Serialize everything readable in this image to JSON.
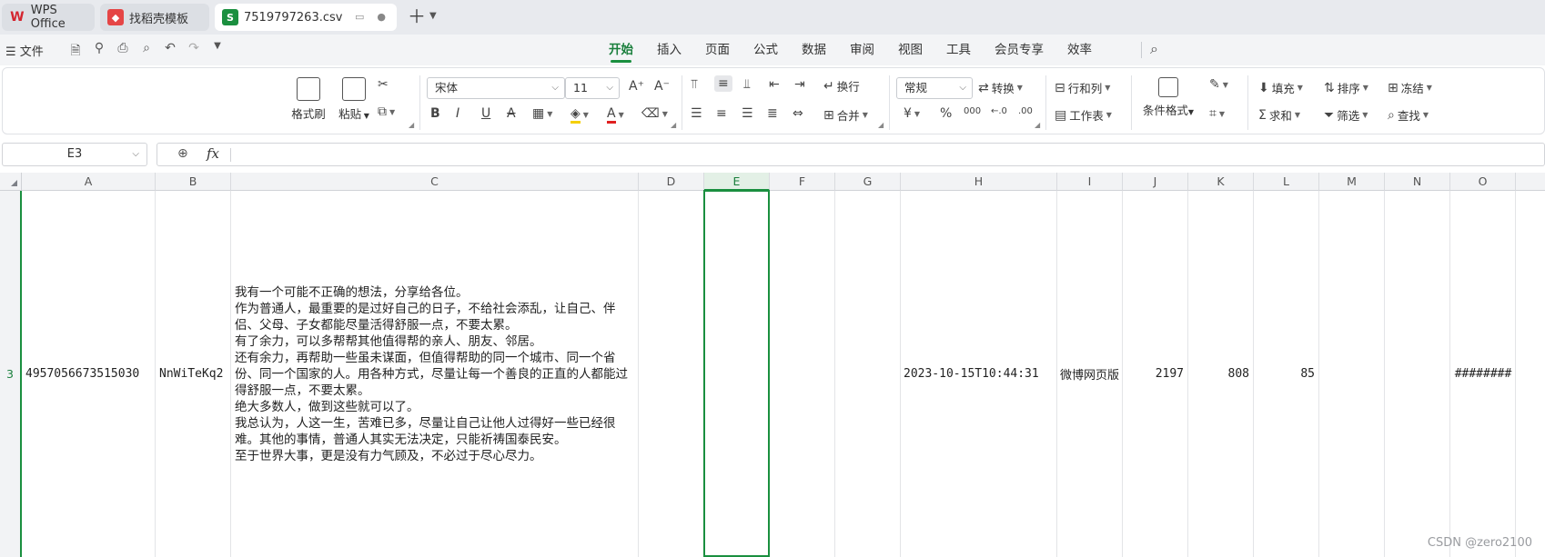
{
  "tabs": [
    {
      "label": "WPS Office",
      "icon": "wps-logo-icon",
      "icon_glyph": "W",
      "icon_color": "#d4252f"
    },
    {
      "label": "找稻壳模板",
      "icon": "docer-icon",
      "icon_glyph": "◆",
      "icon_color": "#e54545"
    },
    {
      "label": "7519797263.csv",
      "icon": "spreadsheet-icon",
      "icon_glyph": "S",
      "icon_color": "#1a8f3f"
    }
  ],
  "menubar": {
    "file_label": "文件",
    "tabs": [
      "开始",
      "插入",
      "页面",
      "公式",
      "数据",
      "审阅",
      "视图",
      "工具",
      "会员专享",
      "效率"
    ],
    "active_tab": "开始"
  },
  "ribbon": {
    "format_painter": "格式刷",
    "paste": "粘贴",
    "font_name": "宋体",
    "font_size": "11",
    "wrap_text": "换行",
    "merge": "合并",
    "number_format": "常规",
    "convert": "转换",
    "row_col": "行和列",
    "worksheet": "工作表",
    "conditional_format": "条件格式",
    "fill": "填充",
    "sort": "排序",
    "freeze": "冻结",
    "sum": "求和",
    "filter": "筛选",
    "find": "查找",
    "currency_symbol": "¥",
    "percent_symbol": "%",
    "thousands_symbol": "000"
  },
  "formula_bar": {
    "name_box": "E3",
    "fx_label": "fx",
    "content": ""
  },
  "grid": {
    "columns": [
      "A",
      "B",
      "C",
      "D",
      "E",
      "F",
      "G",
      "H",
      "I",
      "J",
      "K",
      "L",
      "M",
      "N",
      "O"
    ],
    "selected_column": "E",
    "row_number": "3",
    "cells": {
      "A": "4957056673515030",
      "B": "NnWiTeKq2",
      "C": [
        "我有一个可能不正确的想法，分享给各位。",
        "作为普通人，最重要的是过好自己的日子，不给社会添乱，让自己、伴侣、父母、子女都能尽量活得舒服一点，不要太累。",
        "有了余力，可以多帮帮其他值得帮的亲人、朋友、邻居。",
        "还有余力，再帮助一些虽未谋面，但值得帮助的同一个城市、同一个省份、同一个国家的人。用各种方式，尽量让每一个善良的正直的人都能过得舒服一点，不要太累。",
        "绝大多数人，做到这些就可以了。",
        "我总认为，人这一生，苦难已多，尽量让自己让他人过得好一些已经很难。其他的事情，普通人其实无法决定，只能祈祷国泰民安。",
        "至于世界大事，更是没有力气顾及，不必过于尽心尽力。"
      ],
      "H": "2023-10-15T10:44:31",
      "I": "微博网页版",
      "J": "2197",
      "K": "808",
      "L": "85",
      "O": "########"
    }
  },
  "watermark": "CSDN @zero2100"
}
